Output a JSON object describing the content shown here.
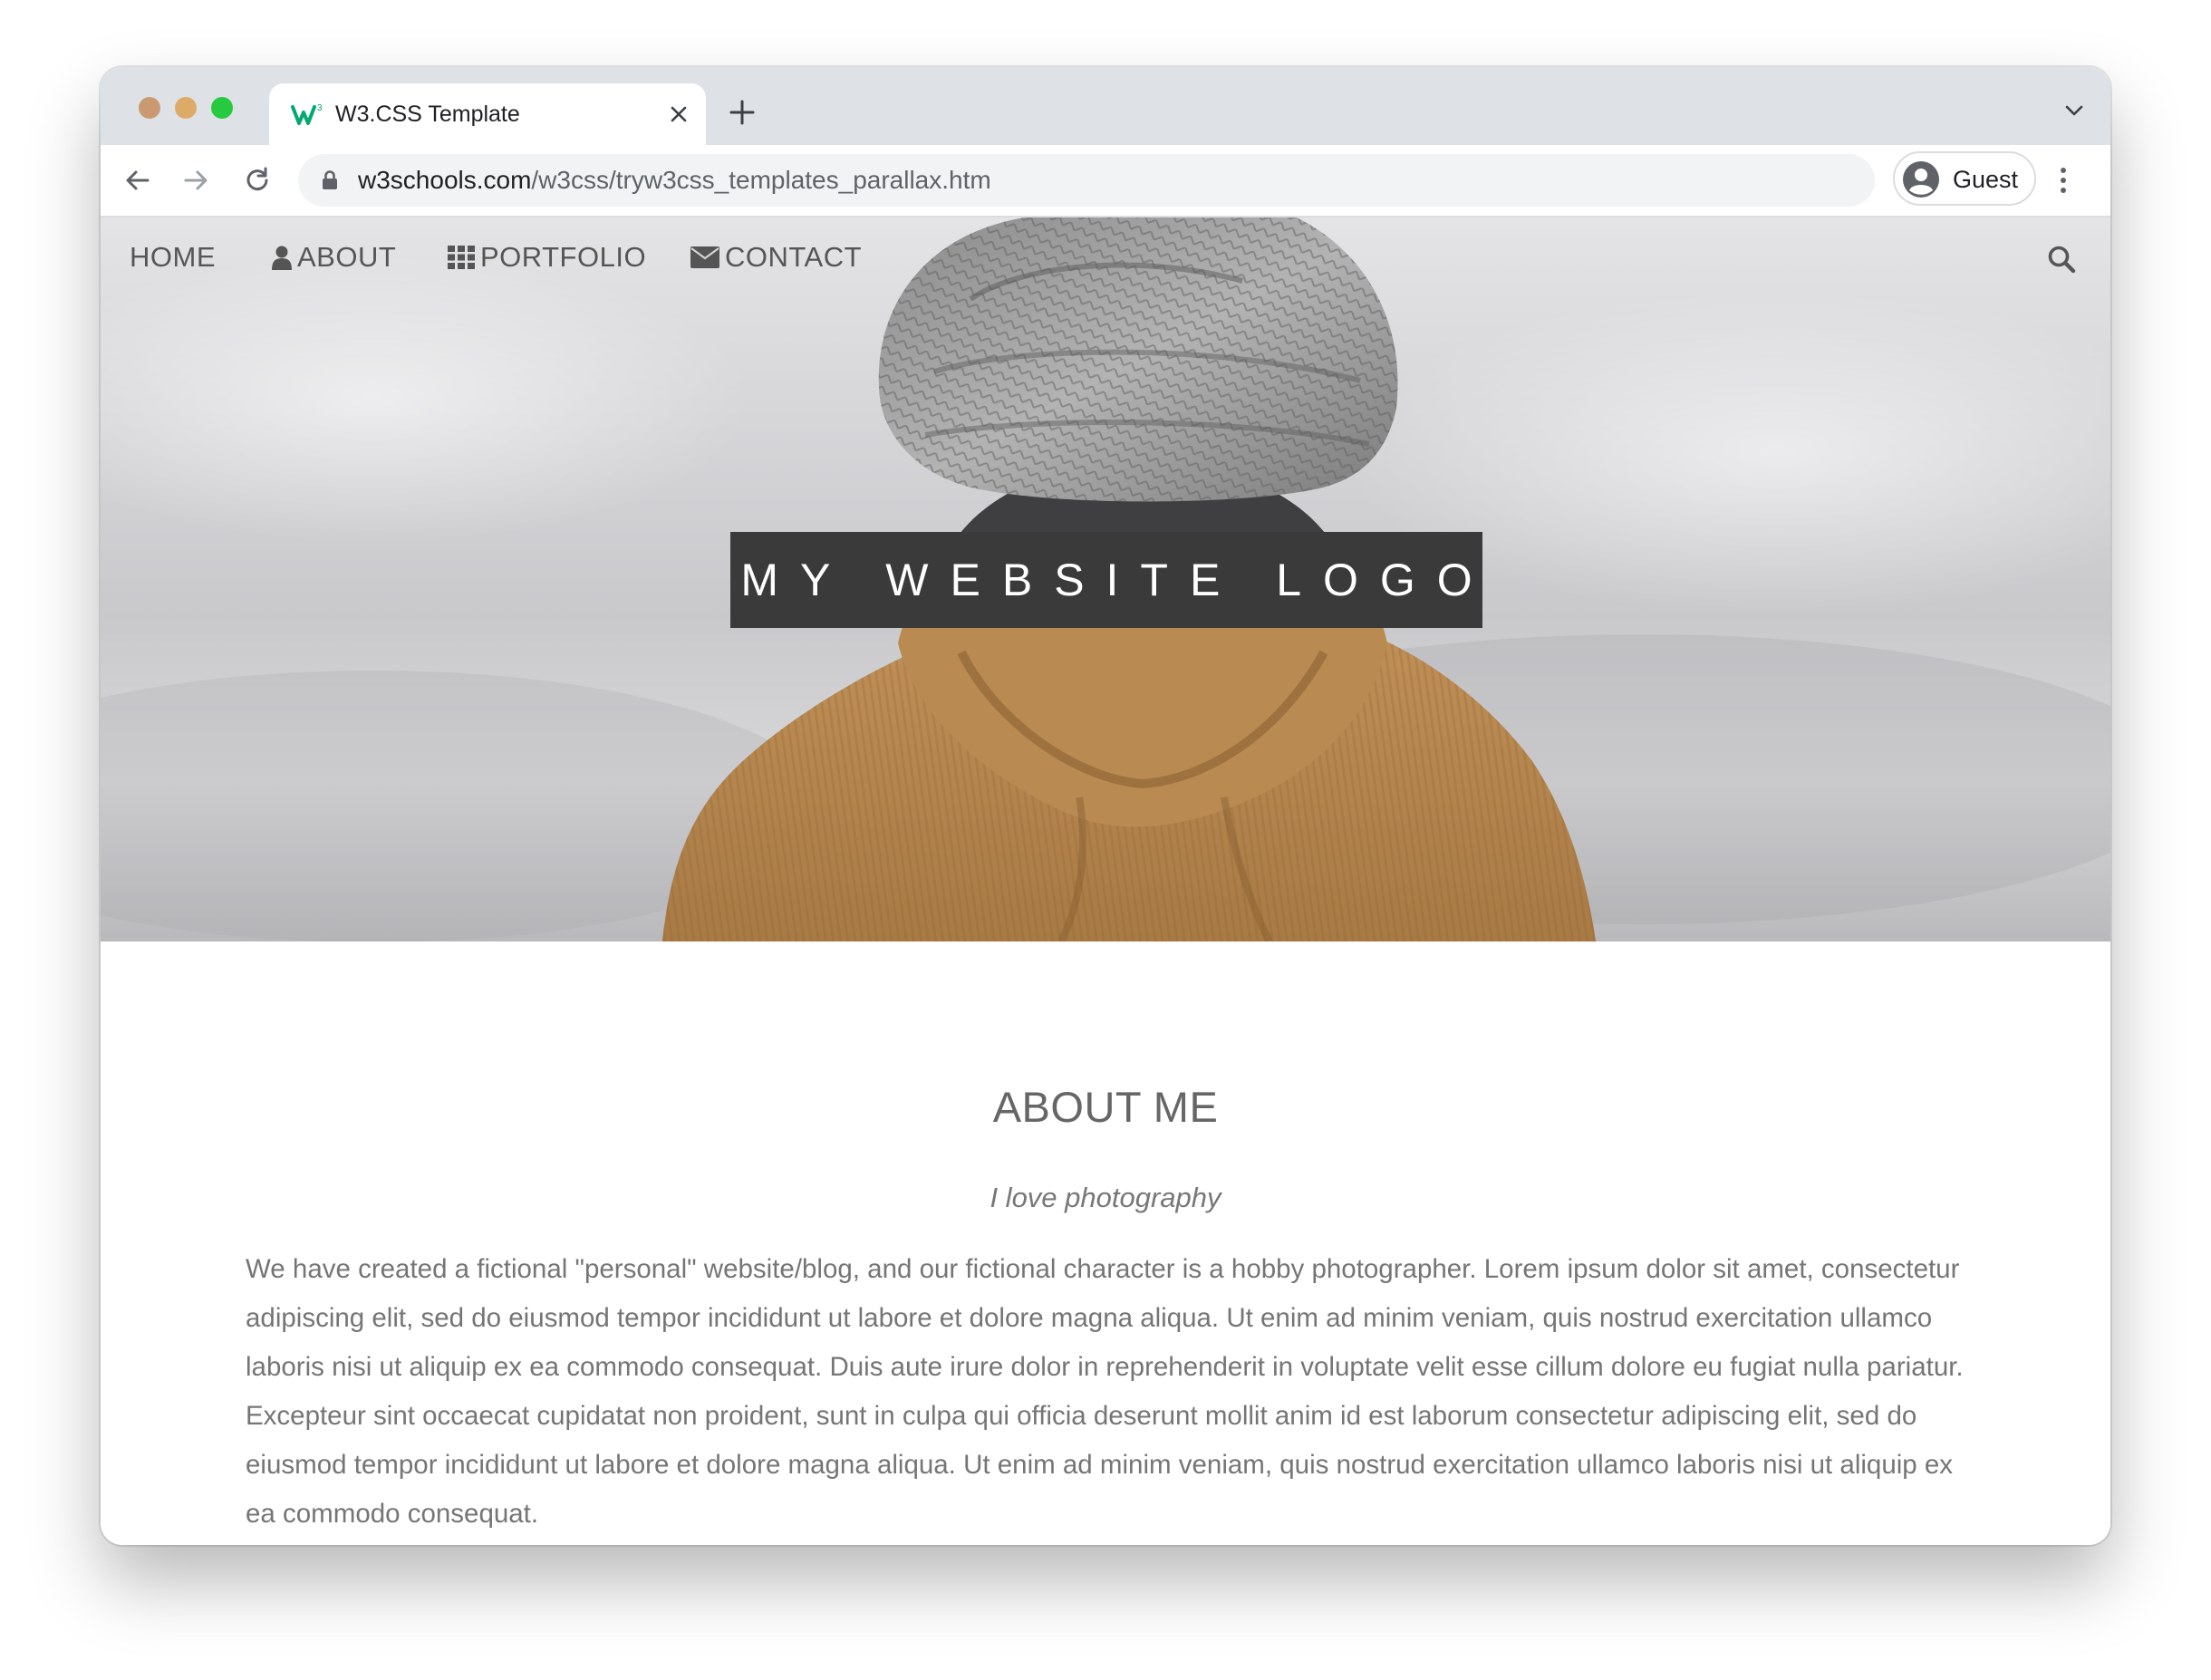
{
  "browser": {
    "tab_title": "W3.CSS Template",
    "url_host": "w3schools.com",
    "url_path": "/w3css/tryw3css_templates_parallax.htm",
    "profile_name": "Guest"
  },
  "nav": {
    "home": "HOME",
    "about": "ABOUT",
    "portfolio": "PORTFOLIO",
    "contact": "CONTACT"
  },
  "hero": {
    "logo_text": "MY WEBSITE LOGO"
  },
  "about": {
    "title": "ABOUT ME",
    "subtitle": "I love photography",
    "body": "We have created a fictional \"personal\" website/blog, and our fictional character is a hobby photographer. Lorem ipsum dolor sit amet, consectetur adipiscing elit, sed do eiusmod tempor incididunt ut labore et dolore magna aliqua. Ut enim ad minim veniam, quis nostrud exercitation ullamco laboris nisi ut aliquip ex ea commodo consequat. Duis aute irure dolor in reprehenderit in voluptate velit esse cillum dolore eu fugiat nulla pariatur. Excepteur sint occaecat cupidatat non proident, sunt in culpa qui officia deserunt mollit anim id est laborum consectetur adipiscing elit, sed do eiusmod tempor incididunt ut labore et dolore magna aliqua. Ut enim ad minim veniam, quis nostrud exercitation ullamco laboris nisi ut aliquip ex ea commodo consequat."
  },
  "colors": {
    "traffic_close": "#c99a71",
    "traffic_minimize": "#dcab67",
    "traffic_zoom": "#27c93f",
    "logo_background": "#3a3a3a",
    "jacket": "#b6854b"
  },
  "icons": {
    "favicon": "w3schools-icon",
    "about": "user-icon",
    "portfolio": "grid-icon",
    "contact": "envelope-icon",
    "search": "search-icon"
  }
}
